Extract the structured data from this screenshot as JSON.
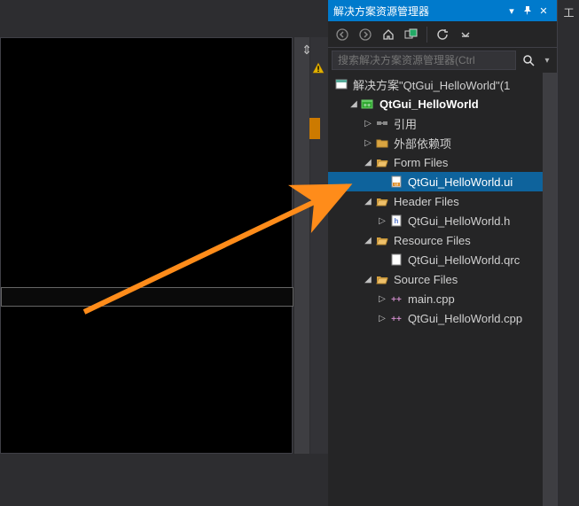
{
  "panel": {
    "title": "解决方案资源管理器",
    "search_placeholder": "搜索解决方案资源管理器(Ctrl",
    "solution_label": "解决方案\"QtGui_HelloWorld\"(1",
    "project": "QtGui_HelloWorld",
    "references": "引用",
    "externals": "外部依赖项",
    "form_files": "Form Files",
    "form_ui": "QtGui_HelloWorld.ui",
    "header_files": "Header Files",
    "header_h": "QtGui_HelloWorld.h",
    "resource_files": "Resource Files",
    "resource_qrc": "QtGui_HelloWorld.qrc",
    "source_files": "Source Files",
    "main_cpp": "main.cpp",
    "gui_cpp": "QtGui_HelloWorld.cpp"
  },
  "rside": {
    "label": "工"
  }
}
